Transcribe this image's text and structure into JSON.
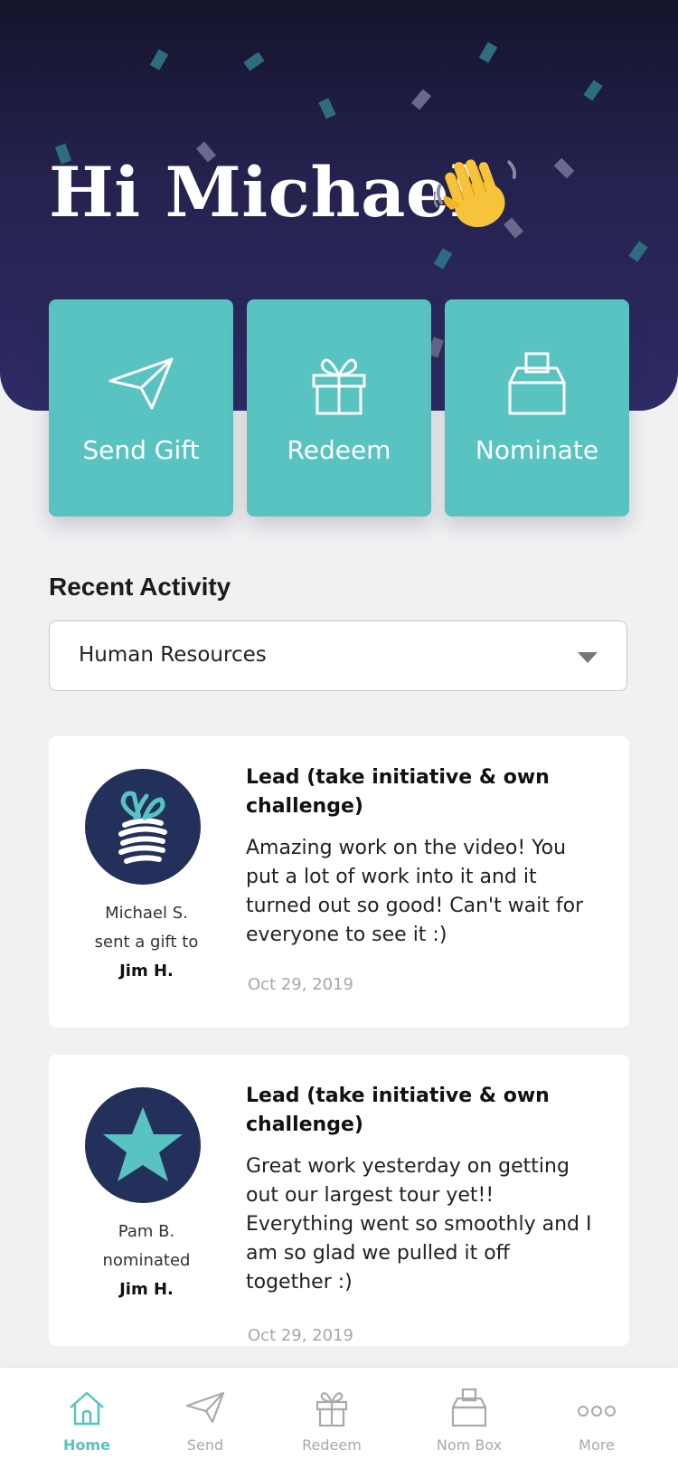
{
  "header": {
    "greeting": "Hi Michael"
  },
  "colors": {
    "accent": "#58c3c0",
    "hero_dark": "#25224f",
    "avatar_bg": "#24305c"
  },
  "quick_actions": [
    {
      "label": "Send Gift",
      "icon": "paper-plane-icon"
    },
    {
      "label": "Redeem",
      "icon": "gift-icon"
    },
    {
      "label": "Nominate",
      "icon": "ballot-box-icon"
    }
  ],
  "recent_activity": {
    "title": "Recent Activity",
    "filter": {
      "selected": "Human Resources"
    },
    "items": [
      {
        "icon": "gift-icon",
        "sender": "Michael S.",
        "action": "sent a gift to",
        "recipient": "Jim H.",
        "title": "Lead (take initiative & own challenge)",
        "message": "Amazing work on the video! You put a lot of work into it and it turned out so good! Can't wait for everyone to see it :)",
        "date": "Oct 29, 2019"
      },
      {
        "icon": "star-icon",
        "sender": "Pam B.",
        "action": "nominated",
        "recipient": "Jim H.",
        "title": "Lead (take initiative & own challenge)",
        "message": "Great work yesterday on getting out our largest tour yet!! Everything went so smoothly and I am so glad we pulled it off together :)",
        "date": "Oct 29, 2019"
      }
    ]
  },
  "tabbar": {
    "active": "Home",
    "items": [
      {
        "label": "Home",
        "icon": "home-icon"
      },
      {
        "label": "Send",
        "icon": "paper-plane-icon"
      },
      {
        "label": "Redeem",
        "icon": "gift-icon"
      },
      {
        "label": "Nom Box",
        "icon": "ballot-box-icon"
      },
      {
        "label": "More",
        "icon": "more-icon"
      }
    ]
  }
}
